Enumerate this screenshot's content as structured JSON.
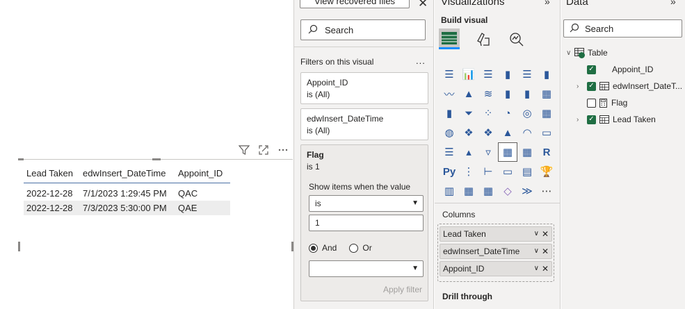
{
  "canvas": {
    "table": {
      "headers": [
        "Lead Taken",
        "edwInsert_DateTime",
        "Appoint_ID"
      ],
      "rows": [
        [
          "2022-12-28",
          "7/1/2023 1:29:45 PM",
          "QAC"
        ],
        [
          "2022-12-28",
          "7/3/2023 5:30:00 PM",
          "QAE"
        ]
      ]
    },
    "toolbar_icons": [
      "filter-icon",
      "focus-mode-icon",
      "more-options-icon"
    ]
  },
  "filters": {
    "recover_label": "View recovered files",
    "search_placeholder": "Search",
    "section_title": "Filters on this visual",
    "more": "...",
    "cards": [
      {
        "name": "Appoint_ID",
        "state": "is (All)"
      },
      {
        "name": "edwInsert_DateTime",
        "state": "is (All)"
      },
      {
        "name": "Flag",
        "state": "is 1"
      }
    ],
    "flag_detail": {
      "show_items_label": "Show items when the value",
      "operator": "is",
      "value": "1",
      "and_label": "And",
      "or_label": "Or",
      "second_operator": "",
      "apply_label": "Apply filter"
    }
  },
  "visualizations": {
    "title": "Visualizations",
    "build_label": "Build visual",
    "columns_label": "Columns",
    "wells": [
      "Lead Taken",
      "edwInsert_DateTime",
      "Appoint_ID"
    ],
    "drill_label": "Drill through"
  },
  "data_pane": {
    "title": "Data",
    "search_placeholder": "Search",
    "table_name": "Table",
    "fields": [
      "Appoint_ID",
      "edwInsert_DateT...",
      "Flag",
      "Lead Taken"
    ]
  },
  "colors": {
    "accent": "#118dff",
    "check": "#1f6e43",
    "table_header_line": "#4a6fa5",
    "alt_row": "#ededed"
  }
}
